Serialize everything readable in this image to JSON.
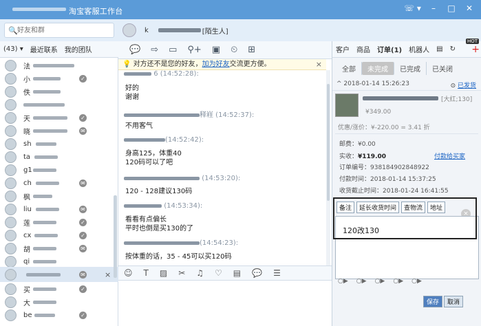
{
  "titlebar": {
    "title": "淘宝客服工作台",
    "win_min": "–",
    "win_max": "□",
    "win_close": "✕",
    "phone": "☏ ▾"
  },
  "search": {
    "placeholder": "好友和群"
  },
  "chat_contact": {
    "tag": "[陌生人]",
    "k": "k"
  },
  "left_tabs": [
    "(43) ▾",
    "最近联系",
    "我的团队"
  ],
  "contacts": [
    {
      "name": "法",
      "status": ""
    },
    {
      "name": "小",
      "status": "✓"
    },
    {
      "name": "佚",
      "status": ""
    },
    {
      "name": "",
      "status": ""
    },
    {
      "name": "天",
      "status": "✓"
    },
    {
      "name": "晓",
      "status": "✉"
    },
    {
      "name": "sh",
      "status": ""
    },
    {
      "name": "ta",
      "status": ""
    },
    {
      "name": "g1",
      "status": ""
    },
    {
      "name": "ch",
      "status": "✉"
    },
    {
      "name": "枫",
      "status": ""
    },
    {
      "name": "liu",
      "status": "✉"
    },
    {
      "name": "莲",
      "status": "✓"
    },
    {
      "name": "cx",
      "status": "✓"
    },
    {
      "name": "胡",
      "status": "✉"
    },
    {
      "name": "qi",
      "status": ""
    },
    {
      "name": "",
      "status": "✉"
    },
    {
      "name": "买",
      "status": "✓"
    },
    {
      "name": "大",
      "status": ""
    },
    {
      "name": "be",
      "status": "✓"
    }
  ],
  "toolbar_icons": [
    "chat-icon",
    "transfer-icon",
    "video-icon",
    "add-user-icon",
    "screen-icon",
    "time-icon",
    "app-icon"
  ],
  "notice": {
    "text": "对方还不是您的好友，",
    "link": "加为好友",
    "rest": "交流更方便。",
    "close": "×"
  },
  "messages": [
    {
      "time": "6 (14:52:28):",
      "lines": [
        "好的",
        "谢谢"
      ]
    },
    {
      "time": "释嵀 (14:52:37):",
      "lines": [
        "不用客气"
      ]
    },
    {
      "time": "(14:52:42):",
      "lines": [
        "身高125，体重40",
        "120码可以了吧"
      ]
    },
    {
      "time": "(14:53:20):",
      "lines": [
        "120 - 128建议130码"
      ]
    },
    {
      "time": "(14:53:34):",
      "lines": [
        "看看有点偏长",
        "平时也倒是买130的了"
      ]
    },
    {
      "time": "(14:54:23):",
      "lines": [
        "按体重的话，35 - 45可以买120码"
      ]
    }
  ],
  "right_tabs": [
    "客户",
    "商品",
    "订单(1)",
    "机器人"
  ],
  "hot": "HOT",
  "filters": [
    "全部",
    "未完成",
    "已完成",
    "已关闭"
  ],
  "order": {
    "date": "2018-01-14 15:26:23",
    "status": "已发货",
    "size": "[大红;130]",
    "price": "¥349.00",
    "discount": "优惠/涨价：¥-220.00 = 3.41 折",
    "postage": "邮费：¥0.00",
    "paid_label": "实收：",
    "paid": "¥119.00",
    "pay_link": "付款给买家",
    "order_no": "订单编号：938184902848922",
    "pay_time": "付款时间：2018-01-14 15:37:25",
    "confirm_time": "收货截止时间：2018-01-24 16:41:55"
  },
  "action_buttons": [
    "备注",
    "延长收货时间",
    "查物流",
    "地址"
  ],
  "remark": {
    "value": "120改130",
    "close": "×"
  },
  "save_buttons": {
    "save": "保存",
    "cancel": "取消"
  },
  "colors": {
    "titlebar": "#5b9bd8",
    "link": "#1a63c4"
  }
}
